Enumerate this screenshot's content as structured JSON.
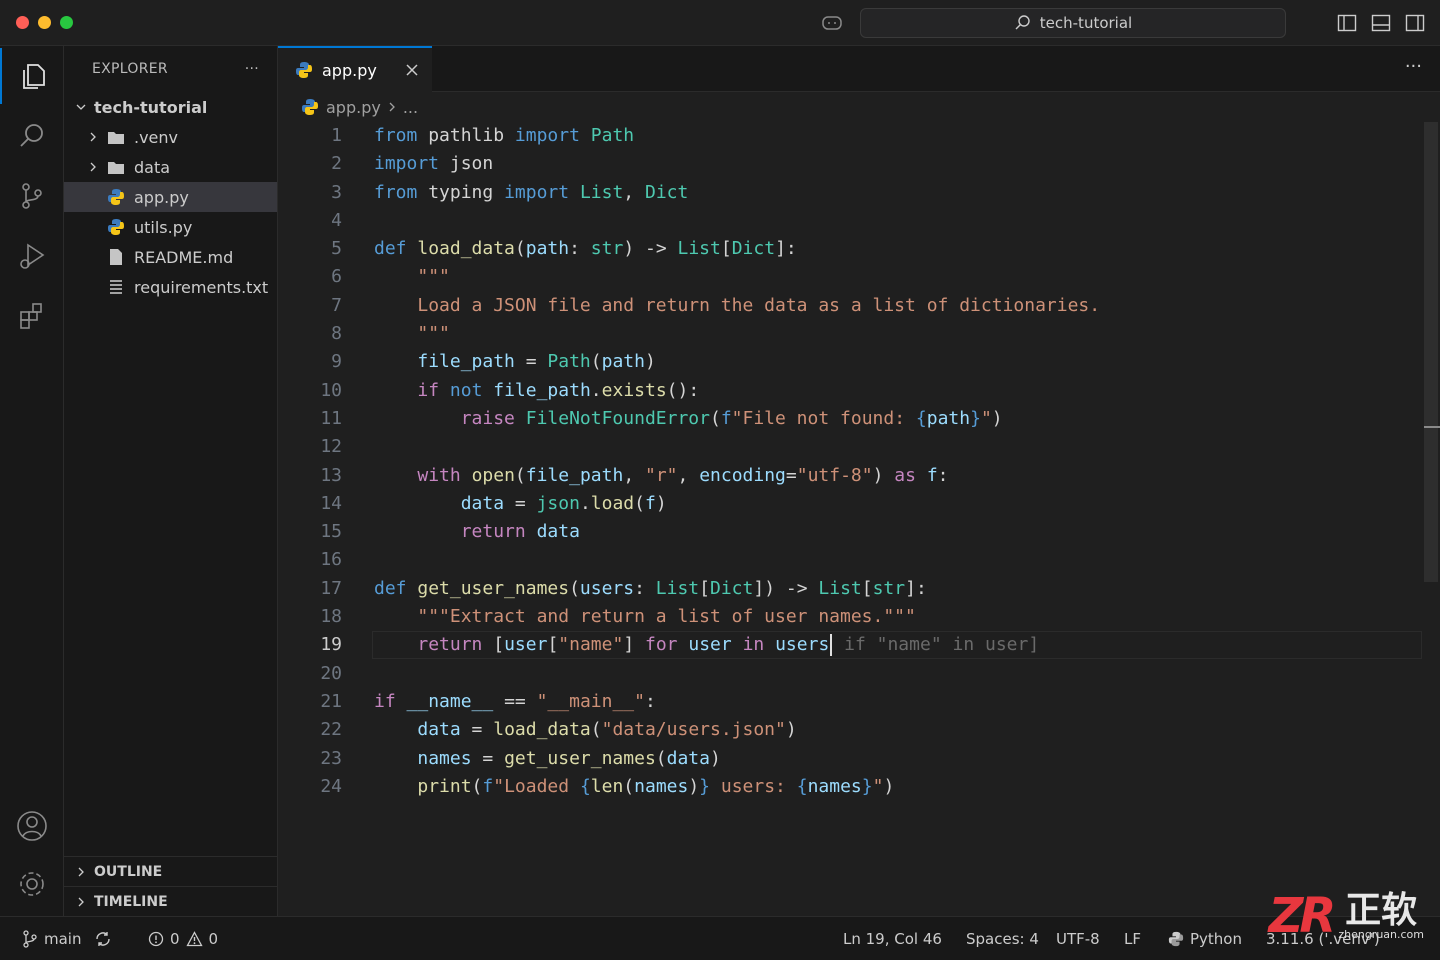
{
  "command_center": {
    "label": "tech-tutorial"
  },
  "sidebar": {
    "header": "EXPLORER",
    "more": "···",
    "root": "tech-tutorial",
    "items": [
      {
        "label": ".venv",
        "kind": "folder"
      },
      {
        "label": "data",
        "kind": "folder"
      },
      {
        "label": "app.py",
        "kind": "python",
        "selected": true
      },
      {
        "label": "utils.py",
        "kind": "python"
      },
      {
        "label": "README.md",
        "kind": "file"
      },
      {
        "label": "requirements.txt",
        "kind": "text"
      }
    ],
    "outline": "OUTLINE",
    "timeline": "TIMELINE"
  },
  "editor": {
    "tab": {
      "label": "app.py"
    },
    "more": "···",
    "breadcrumb": {
      "file": "app.py",
      "rest": "..."
    },
    "current_line": 19,
    "lines": [
      [
        [
          "kw",
          "from"
        ],
        [
          "plain",
          " pathlib "
        ],
        [
          "kw",
          "import"
        ],
        [
          "plain",
          " "
        ],
        [
          "cls",
          "Path"
        ]
      ],
      [
        [
          "kw",
          "import"
        ],
        [
          "plain",
          " json"
        ]
      ],
      [
        [
          "kw",
          "from"
        ],
        [
          "plain",
          " typing "
        ],
        [
          "kw",
          "import"
        ],
        [
          "plain",
          " "
        ],
        [
          "cls",
          "List"
        ],
        [
          "plain",
          ", "
        ],
        [
          "cls",
          "Dict"
        ]
      ],
      [],
      [
        [
          "kw",
          "def"
        ],
        [
          "plain",
          " "
        ],
        [
          "fn",
          "load_data"
        ],
        [
          "plain",
          "("
        ],
        [
          "var",
          "path"
        ],
        [
          "plain",
          ": "
        ],
        [
          "cls",
          "str"
        ],
        [
          "plain",
          ") -> "
        ],
        [
          "cls",
          "List"
        ],
        [
          "plain",
          "["
        ],
        [
          "cls",
          "Dict"
        ],
        [
          "plain",
          "]:"
        ]
      ],
      [
        [
          "plain",
          "    "
        ],
        [
          "doc",
          "\"\"\""
        ]
      ],
      [
        [
          "plain",
          "    "
        ],
        [
          "doc",
          "Load a JSON file and return the data as a list of dictionaries."
        ]
      ],
      [
        [
          "plain",
          "    "
        ],
        [
          "doc",
          "\"\"\""
        ]
      ],
      [
        [
          "plain",
          "    "
        ],
        [
          "var",
          "file_path"
        ],
        [
          "plain",
          " = "
        ],
        [
          "cls",
          "Path"
        ],
        [
          "plain",
          "("
        ],
        [
          "var",
          "path"
        ],
        [
          "plain",
          ")"
        ]
      ],
      [
        [
          "plain",
          "    "
        ],
        [
          "ctrl",
          "if"
        ],
        [
          "plain",
          " "
        ],
        [
          "kw",
          "not"
        ],
        [
          "plain",
          " "
        ],
        [
          "var",
          "file_path"
        ],
        [
          "plain",
          "."
        ],
        [
          "fn",
          "exists"
        ],
        [
          "plain",
          "():"
        ]
      ],
      [
        [
          "plain",
          "        "
        ],
        [
          "ctrl",
          "raise"
        ],
        [
          "plain",
          " "
        ],
        [
          "cls",
          "FileNotFoundError"
        ],
        [
          "plain",
          "("
        ],
        [
          "kw",
          "f"
        ],
        [
          "str",
          "\"File not found: "
        ],
        [
          "brace",
          "{"
        ],
        [
          "var",
          "path"
        ],
        [
          "brace",
          "}"
        ],
        [
          "str",
          "\""
        ],
        [
          "plain",
          ")"
        ]
      ],
      [],
      [
        [
          "plain",
          "    "
        ],
        [
          "ctrl",
          "with"
        ],
        [
          "plain",
          " "
        ],
        [
          "fn",
          "open"
        ],
        [
          "plain",
          "("
        ],
        [
          "var",
          "file_path"
        ],
        [
          "plain",
          ", "
        ],
        [
          "str",
          "\"r\""
        ],
        [
          "plain",
          ", "
        ],
        [
          "var",
          "encoding"
        ],
        [
          "plain",
          "="
        ],
        [
          "str",
          "\"utf-8\""
        ],
        [
          "plain",
          ") "
        ],
        [
          "ctrl",
          "as"
        ],
        [
          "plain",
          " "
        ],
        [
          "var",
          "f"
        ],
        [
          "plain",
          ":"
        ]
      ],
      [
        [
          "plain",
          "        "
        ],
        [
          "var",
          "data"
        ],
        [
          "plain",
          " = "
        ],
        [
          "cls",
          "json"
        ],
        [
          "plain",
          "."
        ],
        [
          "fn",
          "load"
        ],
        [
          "plain",
          "("
        ],
        [
          "var",
          "f"
        ],
        [
          "plain",
          ")"
        ]
      ],
      [
        [
          "plain",
          "        "
        ],
        [
          "ctrl",
          "return"
        ],
        [
          "plain",
          " "
        ],
        [
          "var",
          "data"
        ]
      ],
      [],
      [
        [
          "kw",
          "def"
        ],
        [
          "plain",
          " "
        ],
        [
          "fn",
          "get_user_names"
        ],
        [
          "plain",
          "("
        ],
        [
          "var",
          "users"
        ],
        [
          "plain",
          ": "
        ],
        [
          "cls",
          "List"
        ],
        [
          "plain",
          "["
        ],
        [
          "cls",
          "Dict"
        ],
        [
          "plain",
          "]) -> "
        ],
        [
          "cls",
          "List"
        ],
        [
          "plain",
          "["
        ],
        [
          "cls",
          "str"
        ],
        [
          "plain",
          "]:"
        ]
      ],
      [
        [
          "plain",
          "    "
        ],
        [
          "doc",
          "\"\"\"Extract and return a list of user names.\"\"\""
        ]
      ],
      [
        [
          "plain",
          "    "
        ],
        [
          "ctrl",
          "return"
        ],
        [
          "plain",
          " ["
        ],
        [
          "var",
          "user"
        ],
        [
          "plain",
          "["
        ],
        [
          "str",
          "\"name\""
        ],
        [
          "plain",
          "] "
        ],
        [
          "ctrl",
          "for"
        ],
        [
          "plain",
          " "
        ],
        [
          "var",
          "user"
        ],
        [
          "plain",
          " "
        ],
        [
          "ctrl",
          "in"
        ],
        [
          "plain",
          " "
        ],
        [
          "var",
          "users"
        ],
        [
          "cursor",
          ""
        ],
        [
          "ghost",
          " if \"name\" in user]"
        ]
      ],
      [],
      [
        [
          "ctrl",
          "if"
        ],
        [
          "plain",
          " "
        ],
        [
          "var",
          "__name__"
        ],
        [
          "plain",
          " == "
        ],
        [
          "str",
          "\"__main__\""
        ],
        [
          "plain",
          ":"
        ]
      ],
      [
        [
          "plain",
          "    "
        ],
        [
          "var",
          "data"
        ],
        [
          "plain",
          " = "
        ],
        [
          "fn",
          "load_data"
        ],
        [
          "plain",
          "("
        ],
        [
          "str",
          "\"data/users.json\""
        ],
        [
          "plain",
          ")"
        ]
      ],
      [
        [
          "plain",
          "    "
        ],
        [
          "var",
          "names"
        ],
        [
          "plain",
          " = "
        ],
        [
          "fn",
          "get_user_names"
        ],
        [
          "plain",
          "("
        ],
        [
          "var",
          "data"
        ],
        [
          "plain",
          ")"
        ]
      ],
      [
        [
          "plain",
          "    "
        ],
        [
          "fn",
          "print"
        ],
        [
          "plain",
          "("
        ],
        [
          "kw",
          "f"
        ],
        [
          "str",
          "\"Loaded "
        ],
        [
          "brace",
          "{"
        ],
        [
          "fn",
          "len"
        ],
        [
          "plain",
          "("
        ],
        [
          "var",
          "names"
        ],
        [
          "plain",
          ")"
        ],
        [
          "brace",
          "}"
        ],
        [
          "str",
          " users: "
        ],
        [
          "brace",
          "{"
        ],
        [
          "var",
          "names"
        ],
        [
          "brace",
          "}"
        ],
        [
          "str",
          "\""
        ],
        [
          "plain",
          ")"
        ]
      ]
    ]
  },
  "statusbar": {
    "branch": "main",
    "errors": "0",
    "warnings": "0",
    "position": "Ln 19, Col 46",
    "spaces": "Spaces: 4",
    "encoding": "UTF-8",
    "eol": "LF",
    "language": "Python",
    "interpreter": "3.11.6 ('.venv')"
  },
  "watermark": {
    "text": "正软",
    "sub": "zhengruan.com",
    "logo": "ZR"
  },
  "colors": {
    "accent": "#0078d4",
    "background": "#1f1f1f",
    "sidebar": "#181818"
  }
}
